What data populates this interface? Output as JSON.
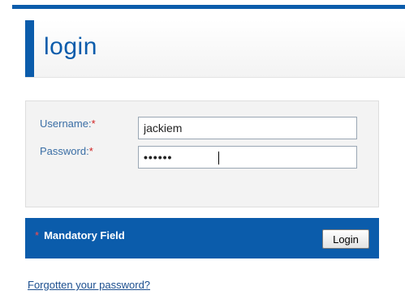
{
  "header": {
    "title": "login"
  },
  "form": {
    "username": {
      "label": "Username:",
      "required_marker": "*",
      "value": "jackiem"
    },
    "password": {
      "label": "Password:",
      "required_marker": "*",
      "value": "••••••"
    }
  },
  "footer_bar": {
    "required_marker": "*",
    "mandatory_text": "Mandatory Field",
    "login_label": "Login"
  },
  "links": {
    "forgot_password": "Forgotten your password?"
  },
  "colors": {
    "accent_blue": "#0b5cab",
    "label_blue": "#3a6ea5",
    "required_red": "#d11f1f",
    "panel_gray": "#f3f3f3"
  }
}
